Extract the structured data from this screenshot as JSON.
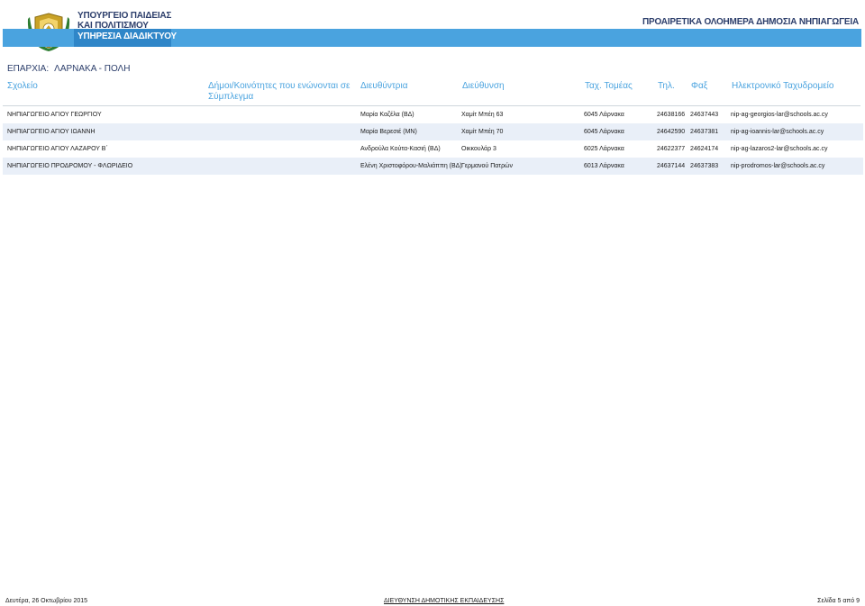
{
  "header": {
    "ministry_line1": "ΥΠΟΥΡΓΕΙΟ ΠΑΙΔΕΙΑΣ",
    "ministry_line2": "ΚΑΙ ΠΟΛΙΤΙΣΜΟΥ",
    "service": "ΥΠΗΡΕΣΙΑ ΔΙΑΔΙΚΤΥΟΥ",
    "doc_title": "ΠΡΟΑΙΡΕΤΙΚΑ ΟΛΟΗΜΕΡΑ ΔΗΜΟΣΙΑ ΝΗΠΙΑΓΩΓΕΙΑ"
  },
  "province": {
    "label": "ΕΠΑΡΧΙΑ:",
    "value": "ΛΑΡΝΑΚΑ - ΠΟΛΗ"
  },
  "columns": {
    "school": "Σχολείο",
    "communities_line1": "Δήμοι/Κοινότητες που ενώνονται σε",
    "communities_line2": "Σύμπλεγμα",
    "principal": "Διευθύντρια",
    "address": "Διεύθυνση",
    "postal": "Ταχ. Τομέας",
    "phone": "Τηλ.",
    "fax": "Φαξ",
    "email": "Ηλεκτρονικό Ταχυδρομείο"
  },
  "rows": [
    {
      "school": "ΝΗΠΙΑΓΩΓΕΙΟ ΑΓΙΟΥ ΓΕΩΡΓΙΟΥ",
      "communities": "",
      "principal": "Μαρία Καζέλα (ΒΔ)",
      "address": "Χαμίτ Μπέη 63",
      "postal": "6045 Λάρνακα",
      "phone": "24638166",
      "fax": "24637443",
      "email": "nip-ag-georgios-lar@schools.ac.cy"
    },
    {
      "school": "ΝΗΠΙΑΓΩΓΕΙΟ ΑΓΙΟΥ ΙΩΑΝΝΗ",
      "communities": "",
      "principal": "Μαρία Βερεσιέ (ΜΝ)",
      "address": "Χαμίτ Μπέη 70",
      "postal": "6045 Λάρνακα",
      "phone": "24642590",
      "fax": "24637381",
      "email": "nip-ag-ioannis-lar@schools.ac.cy"
    },
    {
      "school": "ΝΗΠΙΑΓΩΓΕΙΟ ΑΓΙΟΥ ΛΑΖΑΡΟΥ Β΄",
      "communities": "",
      "principal": "Ανδρούλα Κούτα-Κασιή (ΒΔ)",
      "address": "Οικκουλάρ 3",
      "postal": "6025 Λάρνακα",
      "phone": "24622377",
      "fax": "24624174",
      "email": "nip-ag-lazaros2-lar@schools.ac.cy"
    },
    {
      "school": "ΝΗΠΙΑΓΩΓΕΙΟ ΠΡΟΔΡΟΜΟΥ - ΦΛΩΡΙΔΕΙΟ",
      "communities": "",
      "principal": "Ελένη Χριστοφόρου-Μαλιάππη (ΒΔ)",
      "address": "Γερμανού Πατρών",
      "postal": "6013 Λάρνακα",
      "phone": "24637144",
      "fax": "24637383",
      "email": "nip-prodromos-lar@schools.ac.cy"
    }
  ],
  "footer": {
    "date": "Δευτέρα, 26 Οκτωβρίου 2015",
    "directorate": "ΔΙΕΥΘΥΝΣΗ ΔΗΜΟΤΙΚΗΣ ΕΚΠΑΙΔΕΥΣΗΣ",
    "page": "Σελίδα 5 από 9"
  },
  "colors": {
    "accent": "#4aa3df",
    "accent_dark": "#2f86c8",
    "stripe": "#e9eff8",
    "navy": "#2c3e6b",
    "emblem_gold": "#c9a227",
    "emblem_green": "#2e7d32"
  },
  "icons": {
    "logo": "cyprus-coat-of-arms-icon"
  }
}
